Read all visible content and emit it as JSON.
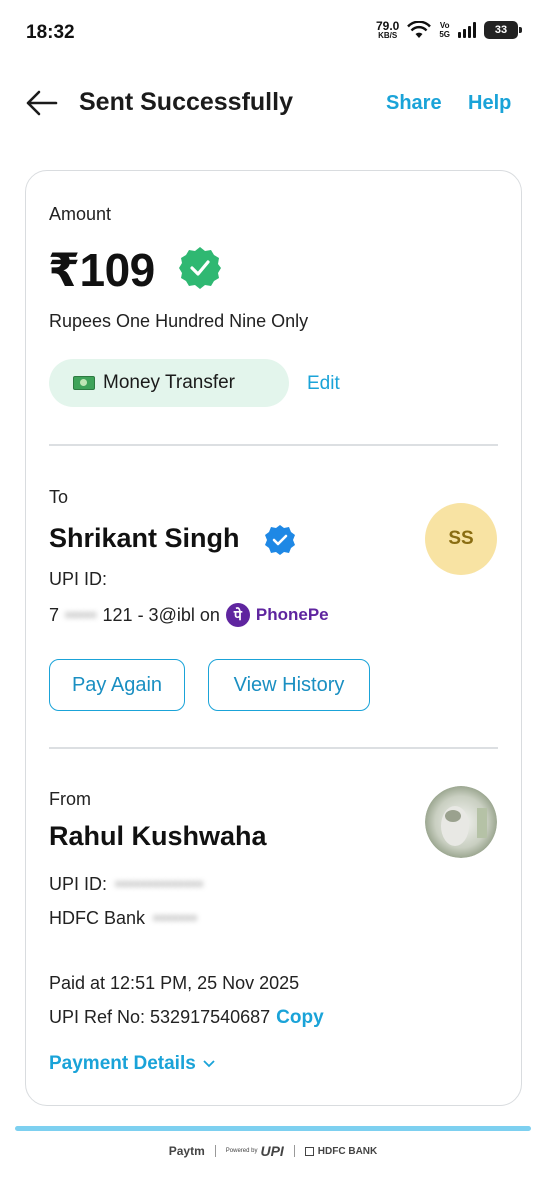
{
  "status_bar": {
    "time": "18:32",
    "net_speed": "79.0",
    "net_unit": "KB/S",
    "volte_top": "Vo",
    "volte_bottom": "5G",
    "battery": "33"
  },
  "header": {
    "title": "Sent Successfully",
    "share_label": "Share",
    "help_label": "Help"
  },
  "amount": {
    "label": "Amount",
    "value": "₹109",
    "in_words": "Rupees One Hundred Nine Only",
    "category": "Money Transfer",
    "edit_label": "Edit"
  },
  "to": {
    "label": "To",
    "name": "Shrikant Singh",
    "avatar_initials": "SS",
    "upi_id_label": "UPI ID:",
    "upi_masked": "7",
    "upi_visible": "121 - 3@ibl on",
    "app_name": "PhonePe",
    "pay_again_label": "Pay Again",
    "view_history_label": "View History"
  },
  "from": {
    "label": "From",
    "name": "Rahul Kushwaha",
    "upi_id_label": "UPI ID:",
    "bank_label": "HDFC Bank",
    "paid_at": "Paid at 12:51 PM, 25 Nov 2025",
    "ref_label": "UPI Ref No: 532917540687",
    "copy_label": "Copy",
    "details_label": "Payment Details"
  },
  "footer": {
    "paytm": "Paytm",
    "powered_by": "Powered by",
    "upi": "UPI",
    "bank": "HDFC BANK"
  },
  "colors": {
    "accent": "#1aa3d8",
    "success_green": "#2fb872",
    "phonepe_purple": "#5f259f",
    "chip_bg": "#e3f5ec",
    "avatar_bg": "#f8e3a3"
  }
}
